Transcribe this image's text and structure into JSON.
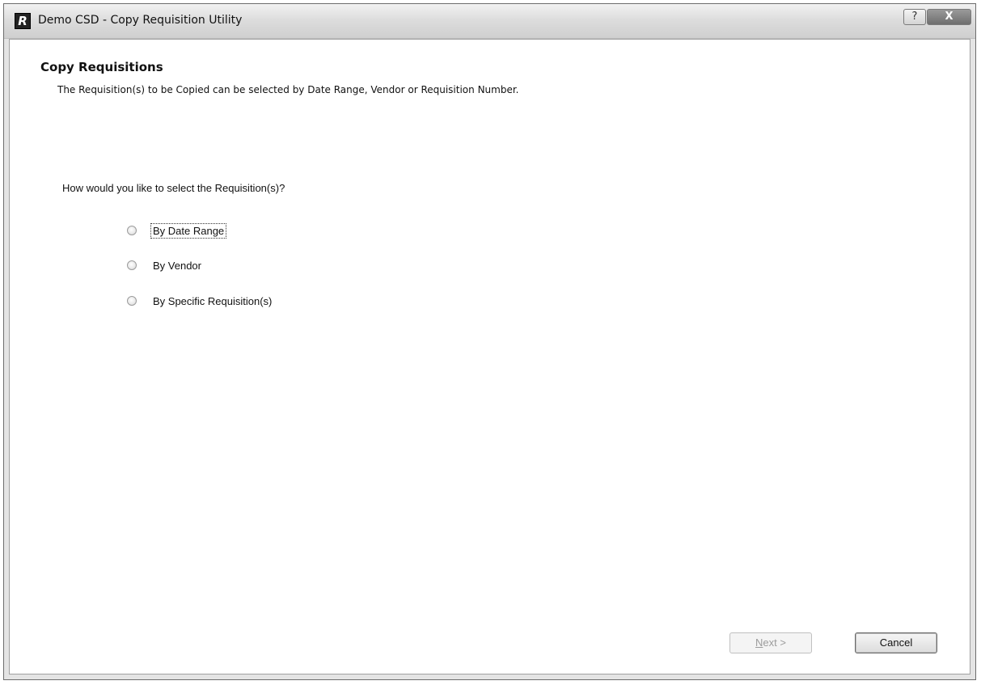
{
  "window": {
    "title": "Demo CSD - Copy Requisition Utility",
    "app_icon_letter": "R",
    "help_label": "?",
    "close_label": "X"
  },
  "page": {
    "heading": "Copy Requisitions",
    "description": "The Requisition(s) to be Copied can be selected by Date Range, Vendor or Requisition Number.",
    "question": "How would you like to select the Requisition(s)?"
  },
  "options": [
    {
      "label": "By Date Range",
      "selected": false,
      "focused": true
    },
    {
      "label": "By Vendor",
      "selected": false,
      "focused": false
    },
    {
      "label": "By Specific Requisition(s)",
      "selected": false,
      "focused": false
    }
  ],
  "buttons": {
    "next_accel": "N",
    "next_rest": "ext >",
    "next_enabled": false,
    "cancel_label": "Cancel"
  }
}
